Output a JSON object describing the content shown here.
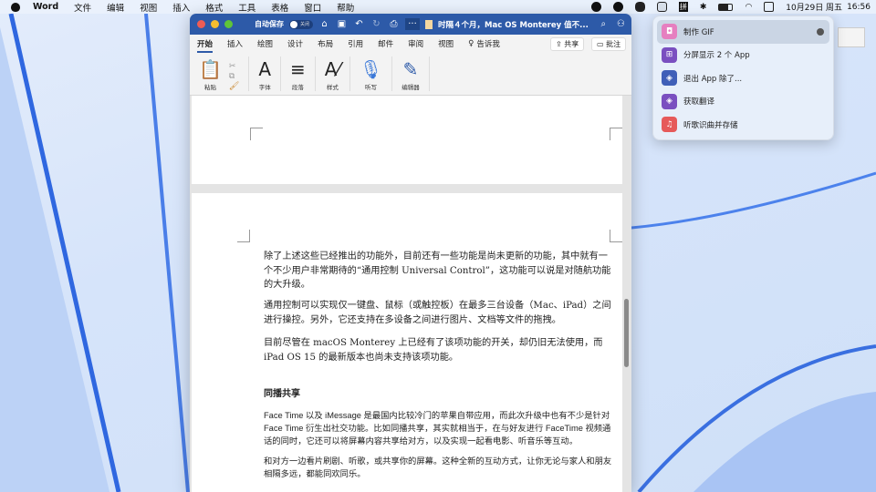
{
  "menubar": {
    "app": "Word",
    "items": [
      "文件",
      "编辑",
      "视图",
      "插入",
      "格式",
      "工具",
      "表格",
      "窗口",
      "帮助"
    ],
    "datetime": "10月29日 周五",
    "time": "16:56",
    "input_method": "拼"
  },
  "window": {
    "autosave_label": "自动保存",
    "autosave_state": "关闭",
    "doc_title": "时隔４个月，Mac OS Monterey 值不..."
  },
  "tabs": [
    "开始",
    "插入",
    "绘图",
    "设计",
    "布局",
    "引用",
    "邮件",
    "审阅",
    "视图"
  ],
  "tell_me": "告诉我",
  "share": "共享",
  "comments": "批注",
  "ribbon": {
    "paste": "粘贴",
    "font": "字体",
    "paragraph": "段落",
    "styles": "样式",
    "dictate": "听写",
    "editor": "编辑器"
  },
  "document": {
    "p1": "除了上述这些已经推出的功能外，目前还有一些功能是尚未更新的功能，其中就有一个不少用户非常期待的“通用控制 Universal Control”，这功能可以说是对随航功能的大升级。",
    "p2": "通用控制可以实现仅一键盘、鼠标（或触控板）在最多三台设备（Mac、iPad）之间进行操控。另外，它还支持在多设备之间进行图片、文档等文件的拖拽。",
    "p3": "目前尽管在 macOS Monterey 上已经有了该项功能的开关，却仍旧无法使用，而 iPad OS 15 的最新版本也尚未支持该项功能。",
    "heading": "同播共享",
    "p4": "Face Time 以及 iMessage 是最国内比较冷门的苹果自带应用，而此次升级中也有不少是针对 Face Time 衍生出社交功能。比如同播共享，其实就相当于，在与好友进行 FaceTime 视频通话的同时，它还可以将屏幕内容共享给对方，以及实现一起看电影、听音乐等互动。",
    "p5": "和对方一边看片刷剧、听歌，或共享你的屏幕。这种全新的互动方式，让你无论与家人和朋友相隔多远，都能同欢同乐。"
  },
  "shortcuts_menu": [
    {
      "label": "制作 GIF",
      "color": "#e67fc0"
    },
    {
      "label": "分屏显示 2 个 App",
      "color": "#7a4fc0"
    },
    {
      "label": "退出 App 除了...",
      "color": "#3f5fb8"
    },
    {
      "label": "获取翻译",
      "color": "#7a4fc0"
    },
    {
      "label": "听歌识曲并存储",
      "color": "#e65a5a"
    }
  ]
}
